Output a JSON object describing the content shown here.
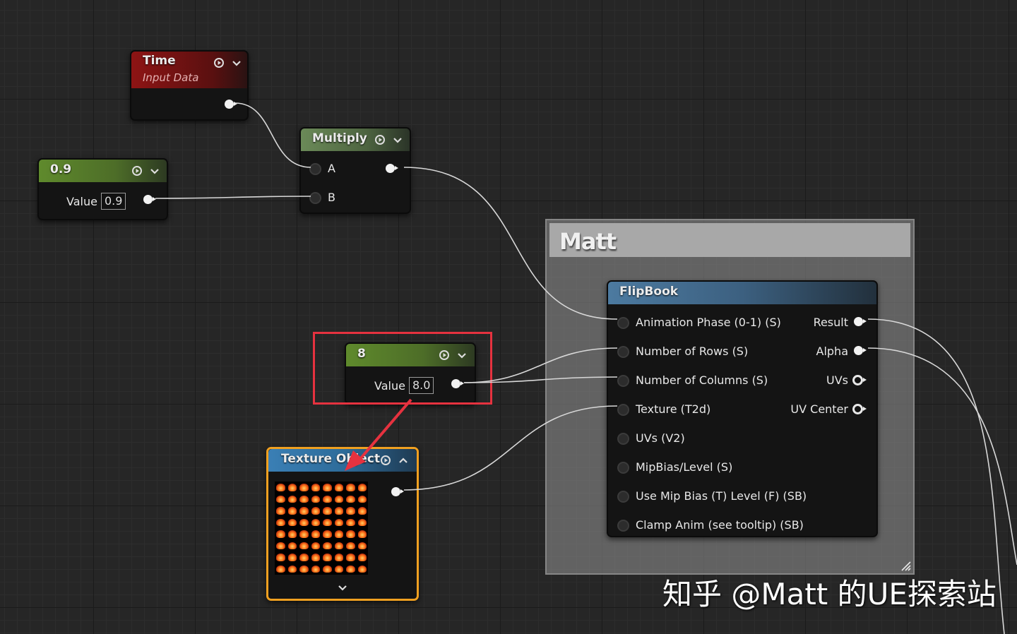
{
  "canvas": {
    "background": "#262626"
  },
  "nodes": {
    "time": {
      "title": "Time",
      "subtitle": "Input Data",
      "color": "#8e1414"
    },
    "constant09": {
      "title": "0.9",
      "value_label": "Value",
      "value": "0.9",
      "color": "#5a7a30"
    },
    "multiply": {
      "title": "Multiply",
      "pin_a": "A",
      "pin_b": "B",
      "color": "#5d7a4a"
    },
    "constant8": {
      "title": "8",
      "value_label": "Value",
      "value": "8.0",
      "color": "#5a7a30"
    },
    "texture_object": {
      "title": "Texture Object",
      "color": "#2e6c9a",
      "thumbnail": "flipbook-fire-sprite-sheet-8x8"
    },
    "flipbook": {
      "title": "FlipBook",
      "color": "#3c6080",
      "inputs": [
        "Animation  Phase (0-1) (S)",
        "Number of Rows (S)",
        "Number of Columns (S)",
        "Texture (T2d)",
        "UVs (V2)",
        "MipBias/Level (S)",
        "Use Mip Bias (T) Level (F) (SB)",
        "Clamp Anim (see tooltip) (SB)"
      ],
      "outputs": [
        "Result",
        "Alpha",
        "UVs",
        "UV Center"
      ]
    }
  },
  "comment": {
    "title": "Matt"
  },
  "annotations": {
    "highlight_color": "#e6323f",
    "arrow_color": "#e6323f"
  },
  "watermark": "知乎 @Matt 的UE探索站",
  "icons": [
    "preview-toggle-icon",
    "collapse-chevron-icon",
    "expand-chevron-icon",
    "resize-grip-icon"
  ]
}
